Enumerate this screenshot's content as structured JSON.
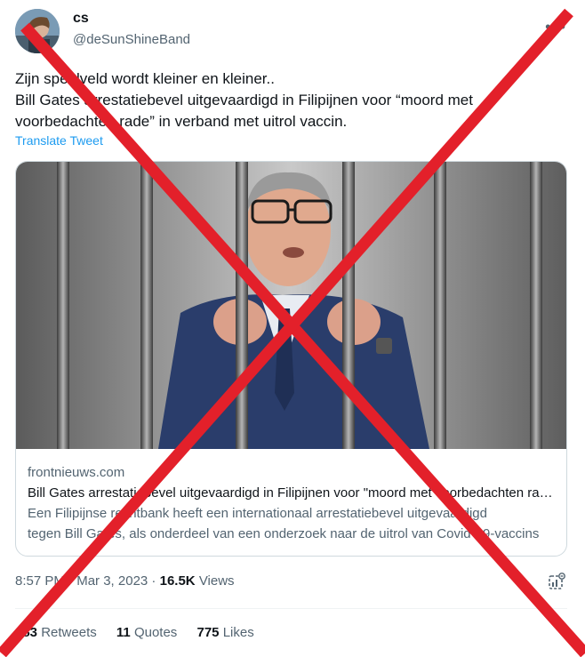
{
  "user": {
    "name": "cs",
    "handle": "@deSunShineBand"
  },
  "tweet": {
    "lines": [
      "Zijn speelveld wordt kleiner en kleiner..",
      "Bill Gates arrestatiebevel uitgevaardigd in Filipijnen voor “moord met",
      "voorbedachten rade” in verband met uitrol vaccin."
    ],
    "translate_label": "Translate Tweet"
  },
  "card": {
    "domain": "frontnieuws.com",
    "title": "Bill Gates arrestatiebevel uitgevaardigd in Filipijnen voor \"moord met voorbedachten rade\" in verband met uitrol vaccin",
    "description_lines": [
      "Een Filipijnse rechtbank heeft een internationaal arrestatiebevel uitgevaardigd",
      "tegen Bill Gates, als onderdeel van een onderzoek naar de uitrol van Covid-19-vaccins"
    ]
  },
  "meta": {
    "time": "8:57 PM",
    "separator": " · ",
    "date": "Mar 3, 2023",
    "views_count": "16.5K",
    "views_label": "Views"
  },
  "stats": {
    "retweets_count": "183",
    "retweets_label": "Retweets",
    "quotes_count": "11",
    "quotes_label": "Quotes",
    "likes_count": "775",
    "likes_label": "Likes"
  },
  "icons": {
    "more": "more-icon",
    "analytics": "analytics-icon"
  },
  "colors": {
    "link": "#1d9bf0",
    "secondary_text": "#536471",
    "overlay_cross": "#e3202a"
  }
}
